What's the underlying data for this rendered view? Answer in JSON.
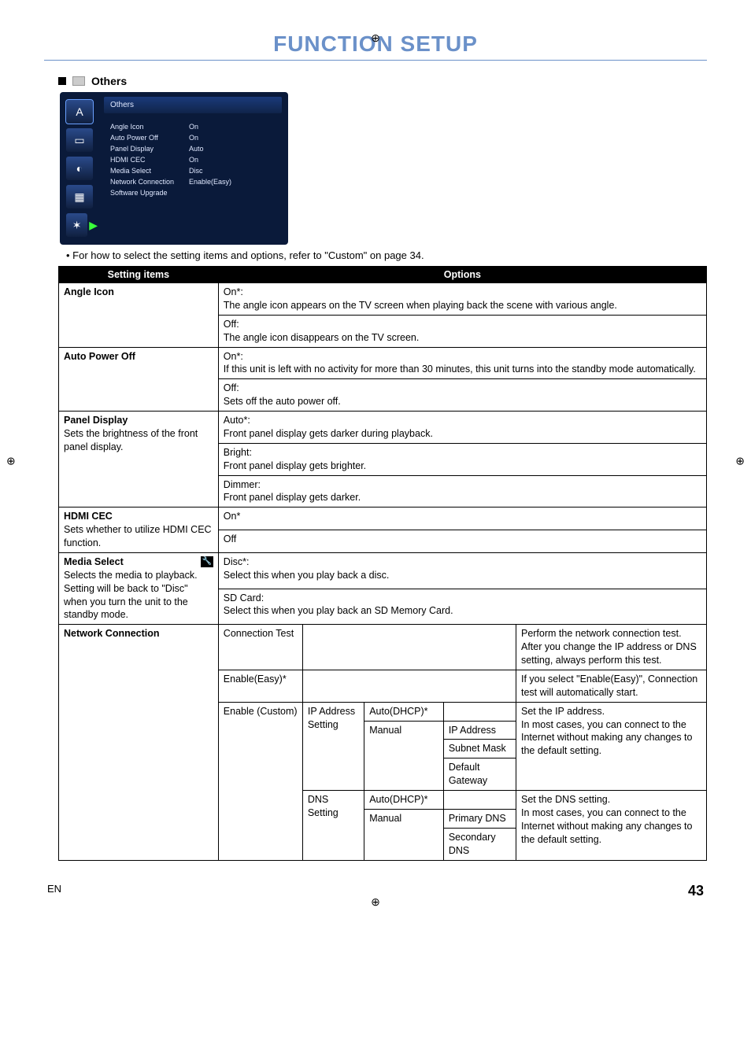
{
  "page": {
    "title": "FUNCTION SETUP",
    "section_heading": "Others",
    "note": "• For how to select the setting items and options, refer to \"Custom\" on page 34.",
    "footer_lang": "EN",
    "footer_page": "43"
  },
  "osd": {
    "header": "Others",
    "icon_letter": "A",
    "rows": [
      {
        "label": "Angle Icon",
        "value": "On"
      },
      {
        "label": "Auto Power Off",
        "value": "On"
      },
      {
        "label": "Panel Display",
        "value": "Auto"
      },
      {
        "label": "HDMI CEC",
        "value": "On"
      },
      {
        "label": "Media Select",
        "value": "Disc"
      },
      {
        "label": "Network Connection",
        "value": "Enable(Easy)"
      },
      {
        "label": "Software Upgrade",
        "value": ""
      }
    ]
  },
  "table": {
    "head_setting": "Setting items",
    "head_options": "Options",
    "rows": {
      "angle_icon": {
        "label": "Angle Icon",
        "opt_on": "On*:\nThe angle icon appears on the TV screen when playing back the scene with various angle.",
        "opt_off": "Off:\nThe angle icon disappears on the TV screen."
      },
      "auto_power_off": {
        "label": "Auto Power Off",
        "opt_on": "On*:\nIf this unit is left with no activity for more than 30 minutes, this unit turns into the standby mode automatically.",
        "opt_off": "Off:\nSets off the auto power off."
      },
      "panel_display": {
        "label": "Panel Display",
        "sub": "Sets the brightness of the front panel display.",
        "opt_auto": "Auto*:\nFront panel display gets darker during playback.",
        "opt_bright": "Bright:\nFront panel display gets brighter.",
        "opt_dimmer": "Dimmer:\nFront panel display gets darker."
      },
      "hdmi_cec": {
        "label": "HDMI CEC",
        "sub": "Sets whether to utilize HDMI CEC function.",
        "opt_on": "On*",
        "opt_off": "Off"
      },
      "media_select": {
        "label": "Media Select",
        "sub": "Selects the media to playback.\nSetting will be back to \"Disc\" when you turn the unit to the standby mode.",
        "opt_disc": "Disc*:\nSelect this when you play back a disc.",
        "opt_sd": "SD Card:\nSelect this when you play back an SD Memory Card."
      },
      "network": {
        "label": "Network Connection",
        "conn_test_label": "Connection Test",
        "conn_test_desc": "Perform the network connection test. After you change the IP address or DNS setting, always perform this test.",
        "enable_easy_label": "Enable(Easy)*",
        "enable_easy_desc": "If you select \"Enable(Easy)\", Connection test will automatically start.",
        "enable_custom_label": "Enable (Custom)",
        "ip_setting_label": "IP Address Setting",
        "ip_auto": "Auto(DHCP)*",
        "ip_manual": "Manual",
        "ip_addr": "IP Address",
        "subnet": "Subnet Mask",
        "gateway": "Default Gateway",
        "ip_desc": "Set the IP address.\nIn most cases, you can connect to the Internet without making any changes to the default setting.",
        "dns_setting_label": "DNS Setting",
        "dns_auto": "Auto(DHCP)*",
        "dns_manual": "Manual",
        "dns_primary": "Primary DNS",
        "dns_secondary": "Secondary DNS",
        "dns_desc": "Set the DNS setting.\nIn most cases, you can connect to the Internet without making any changes to the default setting."
      }
    }
  }
}
